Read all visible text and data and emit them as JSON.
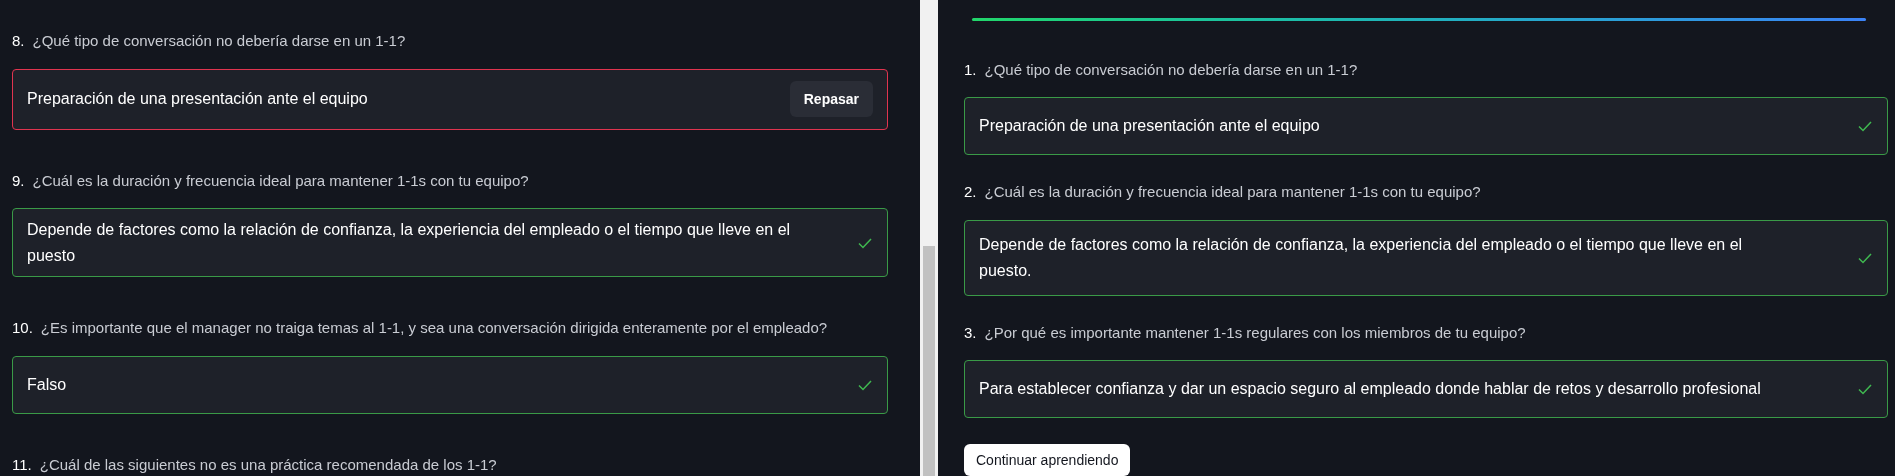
{
  "left_panel": {
    "questions": [
      {
        "number": "8.",
        "text": "¿Qué tipo de conversación no debería darse en un 1-1?",
        "answer": {
          "text": "Preparación de una presentación ante el equipo",
          "correct": false,
          "action": "Repasar"
        }
      },
      {
        "number": "9.",
        "text": "¿Cuál es la duración y frecuencia ideal para mantener 1-1s con tu equipo?",
        "answer": {
          "text": "Depende de factores como la relación de confianza, la experiencia del empleado o el tiempo que lleve en el puesto",
          "correct": true
        }
      },
      {
        "number": "10.",
        "text": "¿Es importante que el manager no traiga temas al 1-1, y sea una conversación dirigida enteramente por el empleado?",
        "answer": {
          "text": "Falso",
          "correct": true
        }
      },
      {
        "number": "11.",
        "text": "¿Cuál de las siguientes no es una práctica recomendada de los 1-1?"
      }
    ]
  },
  "right_panel": {
    "progress": {
      "level": 1
    },
    "questions": [
      {
        "number": "1.",
        "text": "¿Qué tipo de conversación no debería darse en un 1-1?",
        "answer": {
          "text": "Preparación de una presentación ante el equipo",
          "correct": true
        }
      },
      {
        "number": "2.",
        "text": "¿Cuál es la duración y frecuencia ideal para mantener 1-1s con tu equipo?",
        "answer": {
          "text": "Depende de factores como la relación de confianza, la experiencia del empleado o el tiempo que lleve en el puesto.",
          "correct": true
        }
      },
      {
        "number": "3.",
        "text": "¿Por qué es importante mantener 1-1s regulares con los miembros de tu equipo?",
        "answer": {
          "text": "Para establecer confianza y dar un espacio seguro al empleado donde hablar de retos y desarrollo profesional",
          "correct": true
        }
      }
    ],
    "continue_button": "Continuar aprendiendo"
  }
}
